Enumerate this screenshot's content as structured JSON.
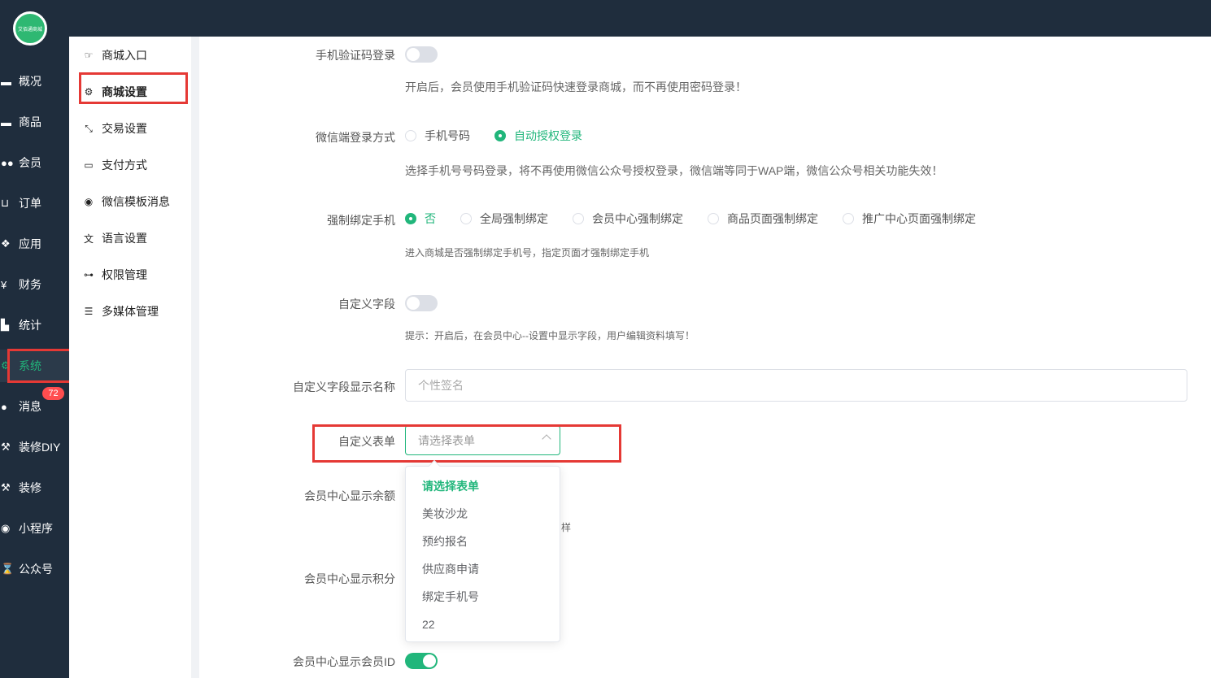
{
  "colors": {
    "accent": "#21b67b",
    "sidebar_bg": "#1f2d3d",
    "highlight": "#e53935",
    "badge": "#ff4d4f"
  },
  "logo": {
    "text": "艾佰通商城"
  },
  "nav": {
    "items": [
      {
        "label": "概况",
        "icon": "archive-icon"
      },
      {
        "label": "商品",
        "icon": "archive-icon"
      },
      {
        "label": "会员",
        "icon": "users-icon"
      },
      {
        "label": "订单",
        "icon": "cart-icon"
      },
      {
        "label": "应用",
        "icon": "cubes-icon"
      },
      {
        "label": "财务",
        "icon": "yen-icon"
      },
      {
        "label": "统计",
        "icon": "bar-chart-icon"
      },
      {
        "label": "系统",
        "icon": "gears-icon"
      },
      {
        "label": "消息",
        "icon": "comment-icon"
      },
      {
        "label": "装修DIY",
        "icon": "gavel-icon"
      },
      {
        "label": "装修",
        "icon": "gavel-icon"
      },
      {
        "label": "小程序",
        "icon": "wechat-icon"
      },
      {
        "label": "公众号",
        "icon": "hourglass-icon"
      }
    ],
    "message_badge": "72"
  },
  "subnav": {
    "items": [
      {
        "label": "商城入口",
        "icon": "hand-pointer-icon"
      },
      {
        "label": "商城设置",
        "icon": "gear-icon"
      },
      {
        "label": "交易设置",
        "icon": "compress-icon"
      },
      {
        "label": "支付方式",
        "icon": "credit-card-icon"
      },
      {
        "label": "微信模板消息",
        "icon": "wechat-icon"
      },
      {
        "label": "语言设置",
        "icon": "language-icon"
      },
      {
        "label": "权限管理",
        "icon": "gamepad-icon"
      },
      {
        "label": "多媒体管理",
        "icon": "list-icon"
      }
    ]
  },
  "form": {
    "sms_login": {
      "label": "手机验证码登录",
      "enabled": false,
      "hint": "开启后，会员使用手机验证码快速登录商城，而不再使用密码登录！"
    },
    "wechat_login": {
      "label": "微信端登录方式",
      "options": [
        "手机号码",
        "自动授权登录"
      ],
      "selected": "自动授权登录",
      "hint": "选择手机号号码登录，将不再使用微信公众号授权登录，微信端等同于WAP端，微信公众号相关功能失效！"
    },
    "force_bind": {
      "label": "强制绑定手机",
      "options": [
        "否",
        "全局强制绑定",
        "会员中心强制绑定",
        "商品页面强制绑定",
        "推广中心页面强制绑定"
      ],
      "selected": "否",
      "hint": "进入商城是否强制绑定手机号，指定页面才强制绑定手机"
    },
    "custom_field": {
      "label": "自定义字段",
      "enabled": false,
      "hint": "提示：开启后，在会员中心--设置中显示字段，用户编辑资料填写！"
    },
    "custom_field_name": {
      "label": "自定义字段显示名称",
      "placeholder": "个性签名"
    },
    "custom_form": {
      "label": "自定义表单",
      "placeholder": "请选择表单",
      "options": [
        "请选择表单",
        "美妆沙龙",
        "预约报名",
        "供应商申请",
        "绑定手机号",
        "22"
      ],
      "selected": "请选择表单"
    },
    "show_balance": {
      "label": "会员中心显示余额",
      "partial_hint": "样"
    },
    "show_points": {
      "label": "会员中心显示积分"
    },
    "show_member_id": {
      "label": "会员中心显示会员ID",
      "enabled": true
    }
  }
}
